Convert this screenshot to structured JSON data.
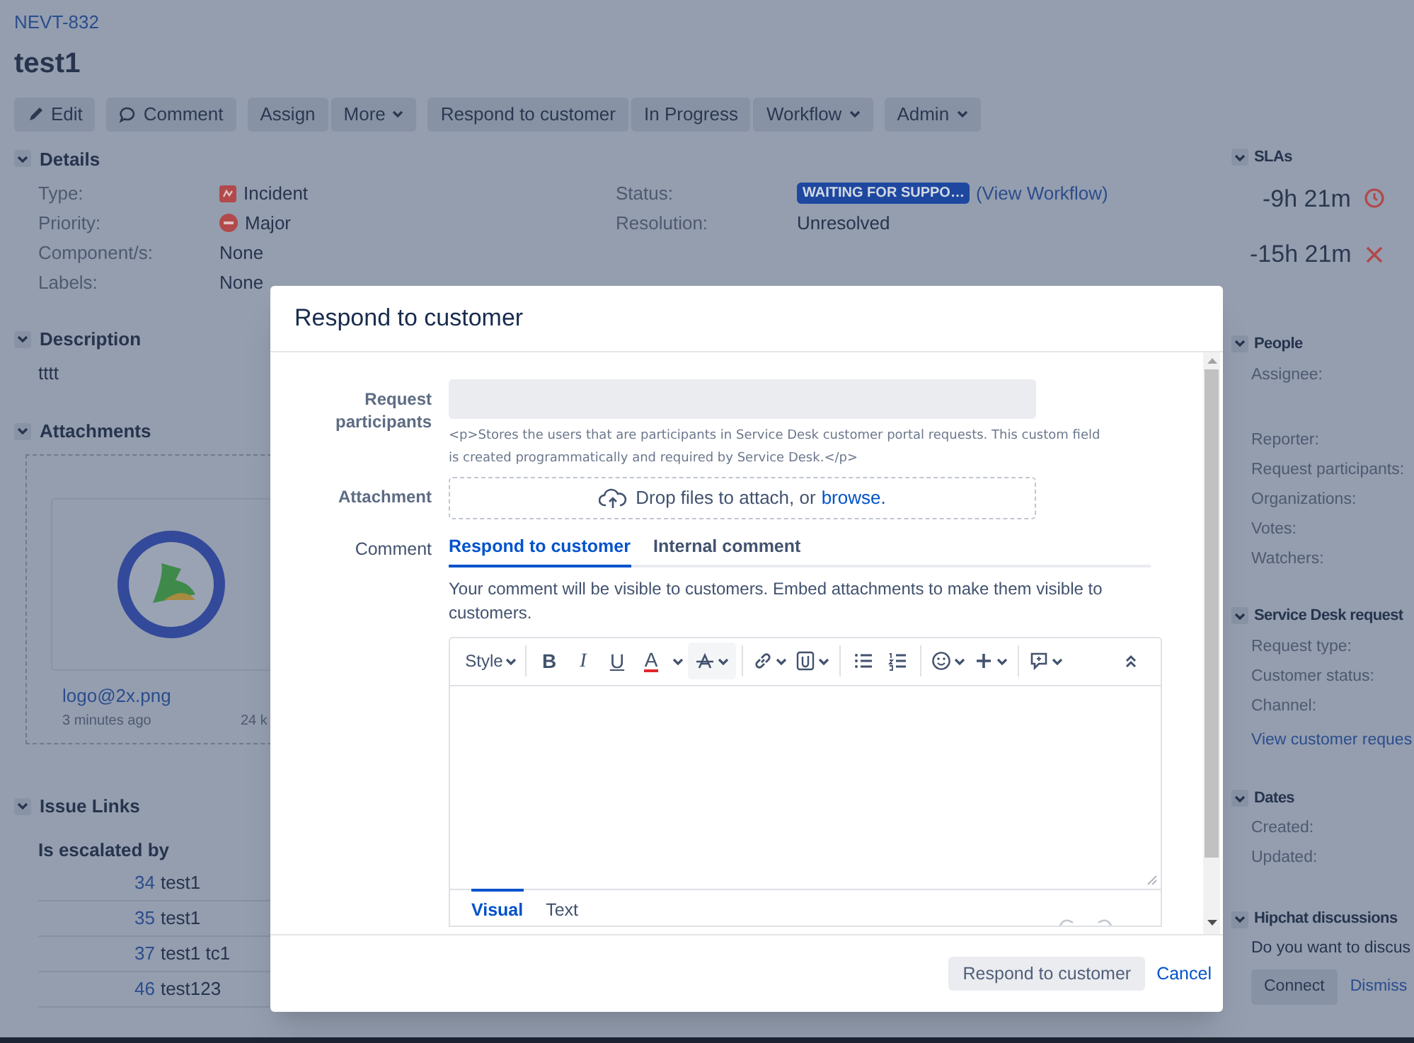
{
  "issue": {
    "key": "NEVT-832",
    "summary": "test1"
  },
  "toolbar": [
    [
      {
        "label": "Edit",
        "kind": "edit",
        "dropdown": false
      }
    ],
    [
      {
        "label": "Comment",
        "kind": "comment",
        "dropdown": false
      }
    ],
    [
      {
        "label": "Assign",
        "dropdown": false
      },
      {
        "label": "More",
        "dropdown": true
      }
    ],
    [
      {
        "label": "Respond to customer",
        "dropdown": false
      },
      {
        "label": "In Progress",
        "dropdown": false
      },
      {
        "label": "Workflow",
        "dropdown": true
      }
    ],
    [
      {
        "label": "Admin",
        "dropdown": true
      }
    ]
  ],
  "details": {
    "title": "Details",
    "left": [
      {
        "label": "Type:",
        "value": "Incident",
        "kind": "incident"
      },
      {
        "label": "Priority:",
        "value": "Major",
        "kind": "major"
      },
      {
        "label": "Component/s:",
        "value": "None"
      },
      {
        "label": "Labels:",
        "value": "None"
      }
    ],
    "status": {
      "label": "Status:",
      "value": "WAITING FOR SUPPO…",
      "link": "(View Workflow)"
    },
    "resolution": {
      "label": "Resolution:",
      "value": "Unresolved"
    }
  },
  "description": {
    "title": "Description",
    "text": "tttt"
  },
  "attachments": {
    "title": "Attachments",
    "file": {
      "name": "logo@2x.png",
      "time": "3 minutes ago",
      "size": "24 k"
    }
  },
  "issue_links": {
    "title": "Issue Links",
    "group": "Is escalated by",
    "rows": [
      {
        "key": "34",
        "summary": "test1"
      },
      {
        "key": "35",
        "summary": "test1"
      },
      {
        "key": "37",
        "summary": "test1 tc1"
      },
      {
        "key": "46",
        "summary": "test123"
      }
    ]
  },
  "sidebar": {
    "slas": {
      "title": "SLAs",
      "items": [
        {
          "time": "-9h 21m",
          "kind": "clock"
        },
        {
          "time": "-15h 21m",
          "kind": "breached"
        }
      ]
    },
    "people": {
      "title": "People",
      "fields": [
        "Assignee:",
        "Reporter:",
        "Request participants:",
        "Organizations:",
        "Votes:",
        "Watchers:"
      ]
    },
    "service_desk": {
      "title": "Service Desk request",
      "fields": [
        "Request type:",
        "Customer status:",
        "Channel:"
      ],
      "link": "View customer reques"
    },
    "dates": {
      "title": "Dates",
      "fields": [
        "Created:",
        "Updated:"
      ]
    },
    "hipchat": {
      "title": "Hipchat discussions",
      "text": "Do you want to discus",
      "connect": "Connect",
      "dismiss": "Dismiss"
    }
  },
  "dialog": {
    "title": "Respond to customer",
    "participants": {
      "label": "Request participants",
      "help": "<p>Stores the users that are participants in Service Desk customer portal requests. This custom field is created programmatically and required by Service Desk.</p>"
    },
    "attachment": {
      "label": "Attachment",
      "text": "Drop files to attach, or",
      "link": "browse."
    },
    "comment": {
      "label": "Comment",
      "tabs": [
        {
          "label": "Respond to customer",
          "selected": true
        },
        {
          "label": "Internal comment",
          "selected": false
        }
      ],
      "note": "Your comment will be visible to customers. Embed attachments to make them visible to customers."
    },
    "editor": {
      "style": "Style",
      "bold": "B",
      "italic": "I",
      "underline": "U",
      "text_color": "A",
      "modes": [
        {
          "label": "Visual",
          "selected": true
        },
        {
          "label": "Text",
          "selected": false
        }
      ]
    },
    "submit": "Respond to customer",
    "cancel": "Cancel"
  }
}
